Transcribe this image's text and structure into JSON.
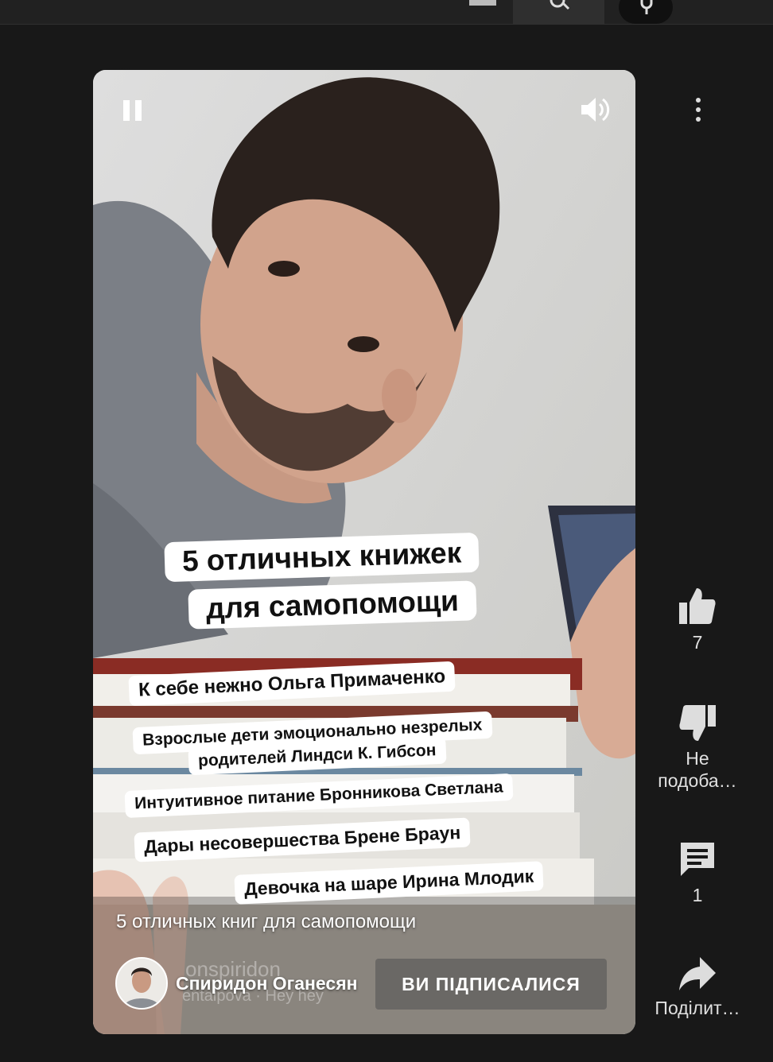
{
  "video": {
    "overlay_title_line1": "5 отличных книжек",
    "overlay_title_line2": "для самопомощи",
    "books": [
      "К себе нежно Ольга Примаченко",
      "Взрослые дети эмоционально незрелых",
      "родителей Линдси К. Гибсон",
      "Интуитивное питание Бронникова Светлана",
      "Дары несовершества Брене Браун",
      "Девочка на шаре Ирина Млодик"
    ],
    "caption": "5 отличных книг для самопомощи",
    "watermark_handle": "onspiridon",
    "watermark_music": "entaipova · Hey hey",
    "channel_name": "Спиридон Оганесян",
    "subscribe_label": "ВИ ПІДПИСАЛИСЯ"
  },
  "actions": {
    "like_count": "7",
    "dislike_label_1": "Не",
    "dislike_label_2": "подоба…",
    "comment_count": "1",
    "share_label": "Поділит…"
  },
  "icons": {
    "pause": "pause-icon",
    "volume": "volume-icon",
    "more": "more-vert-icon",
    "like": "thumb-up-icon",
    "dislike": "thumb-down-icon",
    "comment": "comment-icon",
    "share": "share-icon",
    "search": "search-icon",
    "mic": "mic-icon"
  }
}
